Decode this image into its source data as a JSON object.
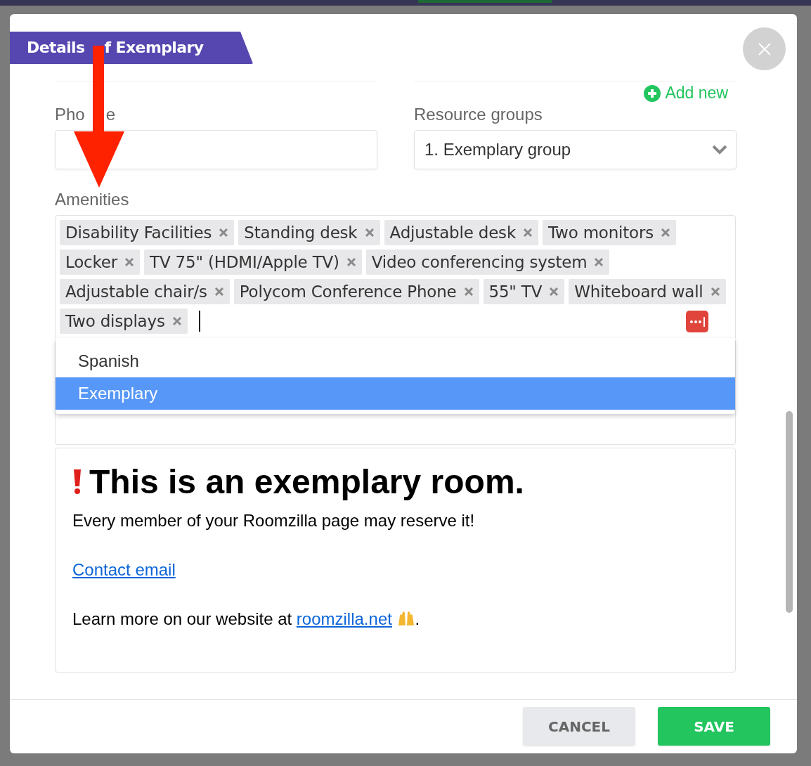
{
  "dialog": {
    "title_parts": [
      "Details",
      "f Exemplary"
    ]
  },
  "add_new": {
    "label": "Add new"
  },
  "phone": {
    "label_parts": [
      "Pho",
      "e"
    ]
  },
  "resource_groups": {
    "label": "Resource groups",
    "value": "1. Exemplary group"
  },
  "amenities": {
    "label": "Amenities",
    "tags": [
      "Disability Facilities",
      "Standing desk",
      "Adjustable desk",
      "Two monitors",
      "Locker",
      "TV 75\" (HDMI/Apple TV)",
      "Video conferencing system",
      "Adjustable chair/s",
      "Polycom Conference Phone",
      "55\" TV",
      "Whiteboard wall",
      "Two displays"
    ],
    "options": [
      {
        "label": "Spanish",
        "selected": false
      },
      {
        "label": "Exemplary",
        "selected": true
      }
    ]
  },
  "editor": {
    "heading": "This is an exemplary room.",
    "paragraphs": [
      {
        "kind": "text",
        "text": "Every member of your Roomzilla page may reserve it!"
      },
      {
        "kind": "link",
        "text": "Contact email"
      },
      {
        "kind": "sentence",
        "before": "Learn more on our website at ",
        "link": "roomzilla.net",
        "after": "."
      }
    ]
  },
  "buttons": [
    {
      "label": "CANCEL",
      "kind": "secondary"
    },
    {
      "label": "SAVE",
      "kind": "primary"
    }
  ]
}
